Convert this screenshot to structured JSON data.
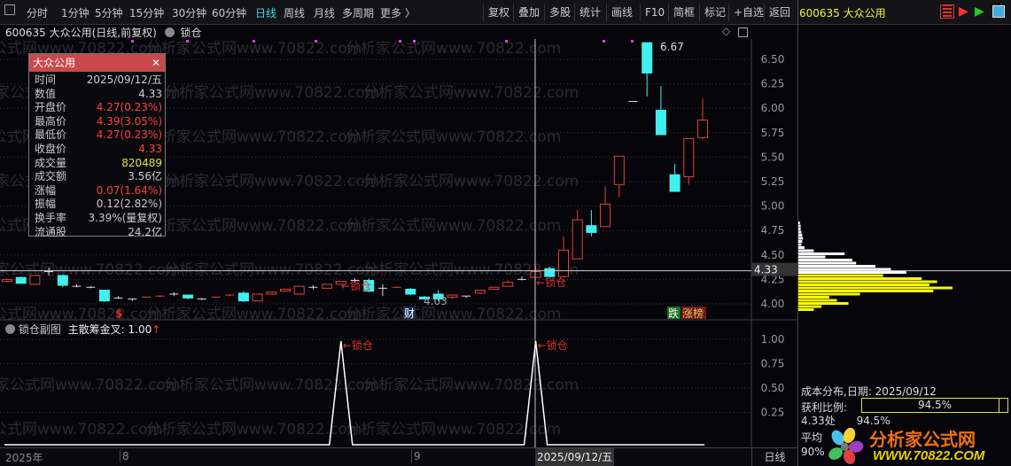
{
  "toolbar": {
    "periods": [
      "分时",
      "1分钟",
      "5分钟",
      "15分钟",
      "30分钟",
      "60分钟",
      "日线",
      "周线",
      "月线",
      "多周期",
      "更多 〉"
    ],
    "active": "日线",
    "actions": [
      "复权",
      "叠加",
      "多股",
      "统计",
      "画线",
      "F10",
      "简框",
      "标记",
      "+自选",
      "返回"
    ]
  },
  "stock_header": "600635 大众公用",
  "chart_title": "600635 大众公用(日线,前复权)",
  "lock_label": "锁仓",
  "watermark": "分析家公式网www.70822.com",
  "info": {
    "title": "大众公用",
    "rows": [
      {
        "k": "时间",
        "v": "2025/09/12/五",
        "c": "wht"
      },
      {
        "k": "数值",
        "v": "4.33",
        "c": "wht"
      },
      {
        "k": "开盘价",
        "v": "4.27(0.23%)",
        "c": "red"
      },
      {
        "k": "最高价",
        "v": "4.39(3.05%)",
        "c": "red"
      },
      {
        "k": "最低价",
        "v": "4.27(0.23%)",
        "c": "red"
      },
      {
        "k": "收盘价",
        "v": "4.33",
        "c": "red"
      },
      {
        "k": "成交量",
        "v": "820489",
        "c": "yel"
      },
      {
        "k": "成交额",
        "v": "3.56亿",
        "c": "wht"
      },
      {
        "k": "涨幅",
        "v": "0.07(1.64%)",
        "c": "red"
      },
      {
        "k": "振幅",
        "v": "0.12(2.82%)",
        "c": "wht"
      },
      {
        "k": "换手率",
        "v": "3.39%(量复权)",
        "c": "wht"
      },
      {
        "k": "流通股",
        "v": "24.2亿",
        "c": "wht"
      }
    ]
  },
  "labels": {
    "high": "6.67",
    "low": "4.03",
    "lock1": "←锁仓",
    "lock2": "←锁仓",
    "cur_price": "4.33",
    "dollar": "$",
    "cai": "财",
    "die": "跌",
    "zhangbang": "涨榜"
  },
  "sub": {
    "title": "锁仓副图",
    "indicator": "主散筹金叉: 1.00",
    "arrow": "↑",
    "lock1": "←锁仓",
    "lock2": "←锁仓",
    "ticks": [
      "1.00",
      "0.75",
      "0.50",
      "0.25"
    ]
  },
  "xaxis": {
    "labels": [
      "2025年",
      "8",
      "9"
    ],
    "cursor_date": "2025/09/12/五",
    "period": "日线"
  },
  "right": {
    "title": "成本分布,日期: 2025/09/12",
    "profit_label": "获利比例:",
    "profit_value": "94.5%",
    "profit_fraction": 0.945,
    "l1": "4.33处",
    "l1v": "94.5%",
    "l2": "平均",
    "l3": "90%",
    "logo_cn": "分析家公式网",
    "logo_url": "WWW.70822.COM"
  },
  "colors": {
    "up": "#e8403c",
    "down": "#40f0f0",
    "bg": "#05050a"
  },
  "chart_data": {
    "type": "candlestick",
    "ylim": [
      3.9,
      6.7
    ],
    "yticks": [
      "6.50",
      "6.25",
      "6.00",
      "5.75",
      "5.50",
      "5.25",
      "5.00",
      "4.75",
      "4.50",
      "4.25",
      "4.00"
    ],
    "candles": [
      [
        4.23,
        4.25,
        4.26,
        4.22
      ],
      [
        4.27,
        4.21,
        4.28,
        4.21
      ],
      [
        4.2,
        4.29,
        4.29,
        4.2
      ],
      [
        4.33,
        4.33,
        4.37,
        4.29
      ],
      [
        4.29,
        4.19,
        4.3,
        4.17
      ],
      [
        4.18,
        4.18,
        4.2,
        4.17
      ],
      [
        4.17,
        4.17,
        4.18,
        4.16
      ],
      [
        4.14,
        4.03,
        4.14,
        4.02
      ],
      [
        4.06,
        4.06,
        4.08,
        4.05
      ],
      [
        4.05,
        4.05,
        4.05,
        4.03
      ],
      [
        4.06,
        4.07,
        4.07,
        4.06
      ],
      [
        4.07,
        4.08,
        4.08,
        4.07
      ],
      [
        4.1,
        4.1,
        4.12,
        4.08
      ],
      [
        4.09,
        4.06,
        4.09,
        4.05
      ],
      [
        4.05,
        4.05,
        4.06,
        4.04
      ],
      [
        4.06,
        4.07,
        4.07,
        4.06
      ],
      [
        4.08,
        4.09,
        4.1,
        4.08
      ],
      [
        4.11,
        4.03,
        4.13,
        4.02
      ],
      [
        4.03,
        4.1,
        4.1,
        4.03
      ],
      [
        4.1,
        4.12,
        4.12,
        4.1
      ],
      [
        4.13,
        4.15,
        4.15,
        4.13
      ],
      [
        4.1,
        4.18,
        4.18,
        4.1
      ],
      [
        4.17,
        4.17,
        4.19,
        4.15
      ],
      [
        4.16,
        4.2,
        4.2,
        4.16
      ],
      [
        4.2,
        4.23,
        4.23,
        4.2
      ],
      [
        4.24,
        4.24,
        4.26,
        4.22
      ],
      [
        4.24,
        4.13,
        4.26,
        4.12
      ],
      [
        4.16,
        4.16,
        4.2,
        4.08
      ],
      [
        4.16,
        4.17,
        4.17,
        4.16
      ],
      [
        4.15,
        4.1,
        4.16,
        4.09
      ],
      [
        4.07,
        4.05,
        4.08,
        4.04
      ],
      [
        4.1,
        4.05,
        4.14,
        4.03
      ],
      [
        4.07,
        4.09,
        4.09,
        4.05
      ],
      [
        4.08,
        4.08,
        4.08,
        4.06
      ],
      [
        4.11,
        4.14,
        4.14,
        4.11
      ],
      [
        4.15,
        4.17,
        4.17,
        4.15
      ],
      [
        4.18,
        4.22,
        4.24,
        4.18
      ],
      [
        4.25,
        4.25,
        4.28,
        4.24
      ],
      [
        4.27,
        4.33,
        4.39,
        4.27
      ],
      [
        4.36,
        4.28,
        4.38,
        4.27
      ],
      [
        4.28,
        4.55,
        4.69,
        4.27
      ],
      [
        4.46,
        4.86,
        4.96,
        4.46
      ],
      [
        4.8,
        4.73,
        4.96,
        4.69
      ],
      [
        4.79,
        5.02,
        5.2,
        4.79
      ],
      [
        5.22,
        5.51,
        5.51,
        5.09
      ],
      [
        6.07,
        6.07,
        6.07,
        6.07
      ],
      [
        6.67,
        6.36,
        6.67,
        6.12
      ],
      [
        5.98,
        5.73,
        6.23,
        5.73
      ],
      [
        5.32,
        5.15,
        5.43,
        5.15
      ],
      [
        5.3,
        5.69,
        5.69,
        5.22
      ],
      [
        5.7,
        5.88,
        6.1,
        5.68
      ]
    ],
    "lock_signals": [
      24,
      38
    ],
    "cost_distribution": [
      2,
      3,
      3,
      4,
      5,
      6,
      5,
      4,
      8,
      20,
      60,
      35,
      70,
      75,
      100,
      120,
      140,
      110,
      160,
      180,
      170,
      200,
      175,
      80,
      40,
      50,
      65,
      30,
      20
    ]
  }
}
